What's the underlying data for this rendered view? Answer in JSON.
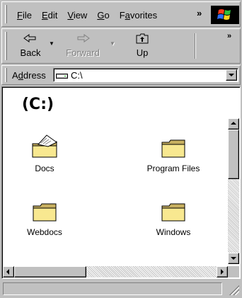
{
  "menu": {
    "items": [
      {
        "pre": "",
        "ul": "F",
        "post": "ile"
      },
      {
        "pre": "",
        "ul": "E",
        "post": "dit"
      },
      {
        "pre": "",
        "ul": "V",
        "post": "iew"
      },
      {
        "pre": "",
        "ul": "G",
        "post": "o"
      },
      {
        "pre": "F",
        "ul": "a",
        "post": "vorites"
      }
    ],
    "more": "»"
  },
  "toolbar": {
    "back_label": "Back",
    "forward_label": "Forward",
    "up_label": "Up",
    "more": "»"
  },
  "address": {
    "label_pre": "A",
    "label_ul": "d",
    "label_post": "dress",
    "value": "C:\\"
  },
  "content": {
    "title": "(C:)",
    "items": [
      {
        "name": "Docs",
        "icon": "shared-folder-icon"
      },
      {
        "name": "Program Files",
        "icon": "folder-icon"
      },
      {
        "name": "Webdocs",
        "icon": "folder-icon"
      },
      {
        "name": "Windows",
        "icon": "folder-icon"
      }
    ]
  },
  "status": {
    "text": ""
  },
  "colors": {
    "face": "#c0c0c0",
    "folder": "#f8e890",
    "folder_dark": "#c8b060"
  }
}
